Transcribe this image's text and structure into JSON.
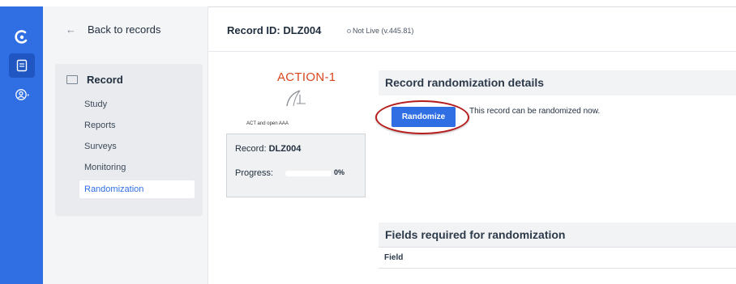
{
  "sidebar": {
    "back_label": "Back to records",
    "section_label": "Record",
    "items": [
      {
        "label": "Study"
      },
      {
        "label": "Reports"
      },
      {
        "label": "Surveys"
      },
      {
        "label": "Monitoring"
      },
      {
        "label": "Randomization",
        "active": true
      }
    ]
  },
  "header": {
    "record_id": "Record ID: DLZ004",
    "status": "Not Live (v.445.81)"
  },
  "logo": {
    "title": "ACTION-1",
    "subtitle": "ACT and open AAA"
  },
  "record_card": {
    "record_label": "Record: ",
    "record_value": "DLZ004",
    "progress_label": "Progress:",
    "progress_value": "0%",
    "progress_fraction": 0
  },
  "randomization": {
    "heading": "Record randomization details",
    "button_label": "Randomize",
    "message": "This record can be randomized now."
  },
  "fields_required": {
    "heading": "Fields required for randomization",
    "column_header": "Field"
  },
  "icons": {
    "rail": [
      "castor-logo-icon",
      "records-icon",
      "user-settings-icon"
    ],
    "back": "arrow-left-icon",
    "section": "folder-icon"
  },
  "colors": {
    "accent": "#2f6fe3",
    "highlight_ring": "#b71c1c",
    "logo_title": "#d9471e"
  }
}
